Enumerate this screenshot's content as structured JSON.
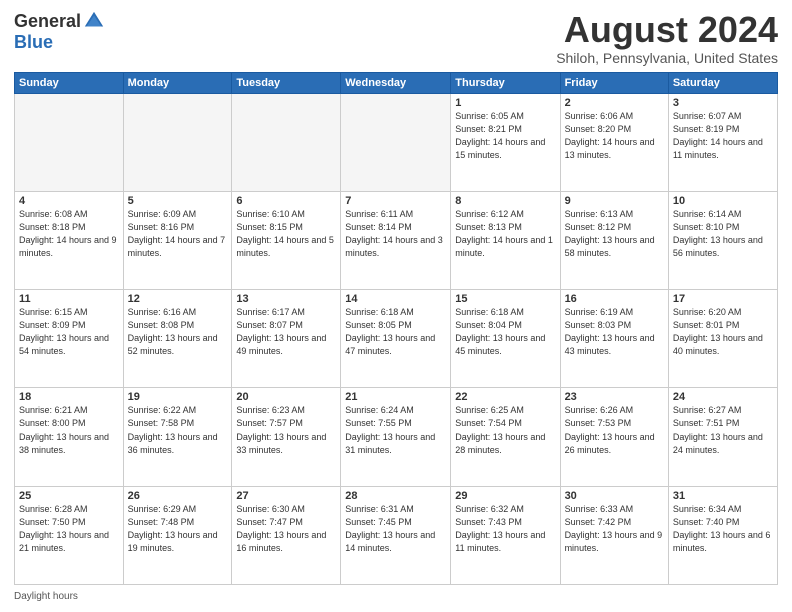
{
  "header": {
    "logo": {
      "general": "General",
      "blue": "Blue"
    },
    "title": "August 2024",
    "location": "Shiloh, Pennsylvania, United States"
  },
  "days_of_week": [
    "Sunday",
    "Monday",
    "Tuesday",
    "Wednesday",
    "Thursday",
    "Friday",
    "Saturday"
  ],
  "weeks": [
    [
      {
        "day": "",
        "info": ""
      },
      {
        "day": "",
        "info": ""
      },
      {
        "day": "",
        "info": ""
      },
      {
        "day": "",
        "info": ""
      },
      {
        "day": "1",
        "info": "Sunrise: 6:05 AM\nSunset: 8:21 PM\nDaylight: 14 hours and 15 minutes."
      },
      {
        "day": "2",
        "info": "Sunrise: 6:06 AM\nSunset: 8:20 PM\nDaylight: 14 hours and 13 minutes."
      },
      {
        "day": "3",
        "info": "Sunrise: 6:07 AM\nSunset: 8:19 PM\nDaylight: 14 hours and 11 minutes."
      }
    ],
    [
      {
        "day": "4",
        "info": "Sunrise: 6:08 AM\nSunset: 8:18 PM\nDaylight: 14 hours and 9 minutes."
      },
      {
        "day": "5",
        "info": "Sunrise: 6:09 AM\nSunset: 8:16 PM\nDaylight: 14 hours and 7 minutes."
      },
      {
        "day": "6",
        "info": "Sunrise: 6:10 AM\nSunset: 8:15 PM\nDaylight: 14 hours and 5 minutes."
      },
      {
        "day": "7",
        "info": "Sunrise: 6:11 AM\nSunset: 8:14 PM\nDaylight: 14 hours and 3 minutes."
      },
      {
        "day": "8",
        "info": "Sunrise: 6:12 AM\nSunset: 8:13 PM\nDaylight: 14 hours and 1 minute."
      },
      {
        "day": "9",
        "info": "Sunrise: 6:13 AM\nSunset: 8:12 PM\nDaylight: 13 hours and 58 minutes."
      },
      {
        "day": "10",
        "info": "Sunrise: 6:14 AM\nSunset: 8:10 PM\nDaylight: 13 hours and 56 minutes."
      }
    ],
    [
      {
        "day": "11",
        "info": "Sunrise: 6:15 AM\nSunset: 8:09 PM\nDaylight: 13 hours and 54 minutes."
      },
      {
        "day": "12",
        "info": "Sunrise: 6:16 AM\nSunset: 8:08 PM\nDaylight: 13 hours and 52 minutes."
      },
      {
        "day": "13",
        "info": "Sunrise: 6:17 AM\nSunset: 8:07 PM\nDaylight: 13 hours and 49 minutes."
      },
      {
        "day": "14",
        "info": "Sunrise: 6:18 AM\nSunset: 8:05 PM\nDaylight: 13 hours and 47 minutes."
      },
      {
        "day": "15",
        "info": "Sunrise: 6:18 AM\nSunset: 8:04 PM\nDaylight: 13 hours and 45 minutes."
      },
      {
        "day": "16",
        "info": "Sunrise: 6:19 AM\nSunset: 8:03 PM\nDaylight: 13 hours and 43 minutes."
      },
      {
        "day": "17",
        "info": "Sunrise: 6:20 AM\nSunset: 8:01 PM\nDaylight: 13 hours and 40 minutes."
      }
    ],
    [
      {
        "day": "18",
        "info": "Sunrise: 6:21 AM\nSunset: 8:00 PM\nDaylight: 13 hours and 38 minutes."
      },
      {
        "day": "19",
        "info": "Sunrise: 6:22 AM\nSunset: 7:58 PM\nDaylight: 13 hours and 36 minutes."
      },
      {
        "day": "20",
        "info": "Sunrise: 6:23 AM\nSunset: 7:57 PM\nDaylight: 13 hours and 33 minutes."
      },
      {
        "day": "21",
        "info": "Sunrise: 6:24 AM\nSunset: 7:55 PM\nDaylight: 13 hours and 31 minutes."
      },
      {
        "day": "22",
        "info": "Sunrise: 6:25 AM\nSunset: 7:54 PM\nDaylight: 13 hours and 28 minutes."
      },
      {
        "day": "23",
        "info": "Sunrise: 6:26 AM\nSunset: 7:53 PM\nDaylight: 13 hours and 26 minutes."
      },
      {
        "day": "24",
        "info": "Sunrise: 6:27 AM\nSunset: 7:51 PM\nDaylight: 13 hours and 24 minutes."
      }
    ],
    [
      {
        "day": "25",
        "info": "Sunrise: 6:28 AM\nSunset: 7:50 PM\nDaylight: 13 hours and 21 minutes."
      },
      {
        "day": "26",
        "info": "Sunrise: 6:29 AM\nSunset: 7:48 PM\nDaylight: 13 hours and 19 minutes."
      },
      {
        "day": "27",
        "info": "Sunrise: 6:30 AM\nSunset: 7:47 PM\nDaylight: 13 hours and 16 minutes."
      },
      {
        "day": "28",
        "info": "Sunrise: 6:31 AM\nSunset: 7:45 PM\nDaylight: 13 hours and 14 minutes."
      },
      {
        "day": "29",
        "info": "Sunrise: 6:32 AM\nSunset: 7:43 PM\nDaylight: 13 hours and 11 minutes."
      },
      {
        "day": "30",
        "info": "Sunrise: 6:33 AM\nSunset: 7:42 PM\nDaylight: 13 hours and 9 minutes."
      },
      {
        "day": "31",
        "info": "Sunrise: 6:34 AM\nSunset: 7:40 PM\nDaylight: 13 hours and 6 minutes."
      }
    ]
  ],
  "daylight_legend": "Daylight hours"
}
